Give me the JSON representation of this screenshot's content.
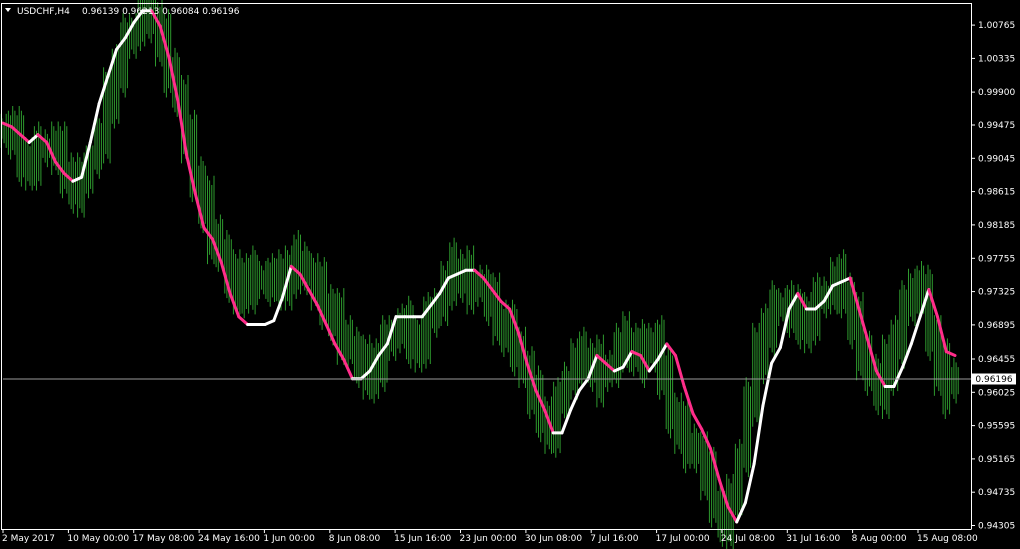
{
  "chart_header": {
    "menu_icon": "triangle-down-icon",
    "symbol": "USDCHF,H4",
    "ohlc": "0.96139 0.96213 0.96084 0.96196"
  },
  "price_label": "0.96196",
  "colors": {
    "background": "#000000",
    "bars": "#2e9a2e",
    "line_up": "#ffffff",
    "line_down": "#ff2d8a",
    "current_price_line": "#9a9a9a",
    "axis": "#ffffff"
  },
  "chart_data": {
    "type": "line",
    "title": "USDCHF,H4",
    "xlabel": "",
    "ylabel": "",
    "ylim": [
      0.9426,
      1.0105
    ],
    "y_ticks": [
      "1.00765",
      "1.00335",
      "0.99900",
      "0.99475",
      "0.99045",
      "0.98615",
      "0.98185",
      "0.97755",
      "0.97325",
      "0.96895",
      "0.96455",
      "0.96025",
      "0.95595",
      "0.95165",
      "0.94735",
      "0.94305"
    ],
    "y_tick_values": [
      1.00765,
      1.00335,
      0.999,
      0.99475,
      0.99045,
      0.98615,
      0.98185,
      0.97755,
      0.97325,
      0.96895,
      0.96455,
      0.96025,
      0.95595,
      0.95165,
      0.94735,
      0.94305
    ],
    "x_ticks": [
      "2 May 2017",
      "10 May 00:00",
      "17 May 08:00",
      "24 May 16:00",
      "1 Jun 00:00",
      "8 Jun 08:00",
      "15 Jun 16:00",
      "23 Jun 00:00",
      "30 Jun 08:00",
      "7 Jul 16:00",
      "17 Jul 00:00",
      "24 Jul 08:00",
      "31 Jul 16:00",
      "8 Aug 00:00",
      "15 Aug 08:00"
    ],
    "current_price": 0.96196,
    "series": [
      {
        "role": "price",
        "values": [
          0.994,
          0.993,
          0.99,
          0.9905,
          0.9915,
          0.992,
          0.991,
          0.9885,
          0.987,
          0.9875,
          0.9905,
          0.993,
          0.998,
          1.0025,
          1.0055,
          1.007,
          1.0095,
          1.0085,
          1.006,
          1.0025,
          0.998,
          0.9925,
          0.988,
          0.9845,
          0.981,
          0.978,
          0.9745,
          0.9735,
          0.9755,
          0.9745,
          0.975,
          0.974,
          0.9745,
          0.9765,
          0.9775,
          0.975,
          0.9735,
          0.9715,
          0.97,
          0.968,
          0.9655,
          0.9635,
          0.9625,
          0.9645,
          0.9665,
          0.968,
          0.9685,
          0.9665,
          0.9675,
          0.9695,
          0.9715,
          0.974,
          0.976,
          0.9755,
          0.9745,
          0.9735,
          0.9715,
          0.9695,
          0.9685,
          0.9665,
          0.963,
          0.9595,
          0.957,
          0.956,
          0.9585,
          0.962,
          0.964,
          0.9645,
          0.964,
          0.9625,
          0.9635,
          0.966,
          0.9665,
          0.966,
          0.965,
          0.967,
          0.962,
          0.9575,
          0.956,
          0.954,
          0.952,
          0.949,
          0.946,
          0.944,
          0.946,
          0.952,
          0.959,
          0.965,
          0.969,
          0.971,
          0.9715,
          0.97,
          0.969,
          0.9705,
          0.972,
          0.973,
          0.9745,
          0.973,
          0.9695,
          0.966,
          0.962,
          0.96,
          0.9635,
          0.9675,
          0.971,
          0.974,
          0.9725,
          0.9675,
          0.9635,
          0.961,
          0.9625
        ]
      },
      {
        "role": "trend_line",
        "values": [
          0.995,
          0.9945,
          0.9935,
          0.9925,
          0.9935,
          0.9925,
          0.99,
          0.9885,
          0.9875,
          0.988,
          0.9925,
          0.9975,
          1.001,
          1.0045,
          1.006,
          1.008,
          1.0095,
          1.0095,
          1.0075,
          1.0035,
          0.998,
          0.991,
          0.986,
          0.9815,
          0.98,
          0.977,
          0.973,
          0.97,
          0.969,
          0.969,
          0.969,
          0.9695,
          0.9725,
          0.9765,
          0.9755,
          0.9735,
          0.9715,
          0.969,
          0.9665,
          0.9645,
          0.962,
          0.962,
          0.963,
          0.965,
          0.9665,
          0.97,
          0.97,
          0.97,
          0.97,
          0.9715,
          0.973,
          0.975,
          0.9755,
          0.976,
          0.976,
          0.975,
          0.9735,
          0.972,
          0.971,
          0.968,
          0.964,
          0.9605,
          0.958,
          0.955,
          0.955,
          0.958,
          0.9605,
          0.962,
          0.965,
          0.964,
          0.963,
          0.9635,
          0.9655,
          0.965,
          0.963,
          0.9645,
          0.9665,
          0.965,
          0.961,
          0.9575,
          0.9555,
          0.953,
          0.949,
          0.9455,
          0.9435,
          0.946,
          0.951,
          0.9585,
          0.964,
          0.966,
          0.971,
          0.973,
          0.971,
          0.971,
          0.972,
          0.974,
          0.9745,
          0.975,
          0.971,
          0.967,
          0.963,
          0.961,
          0.961,
          0.9635,
          0.9665,
          0.97,
          0.9735,
          0.97,
          0.9655,
          0.965
        ]
      }
    ]
  }
}
